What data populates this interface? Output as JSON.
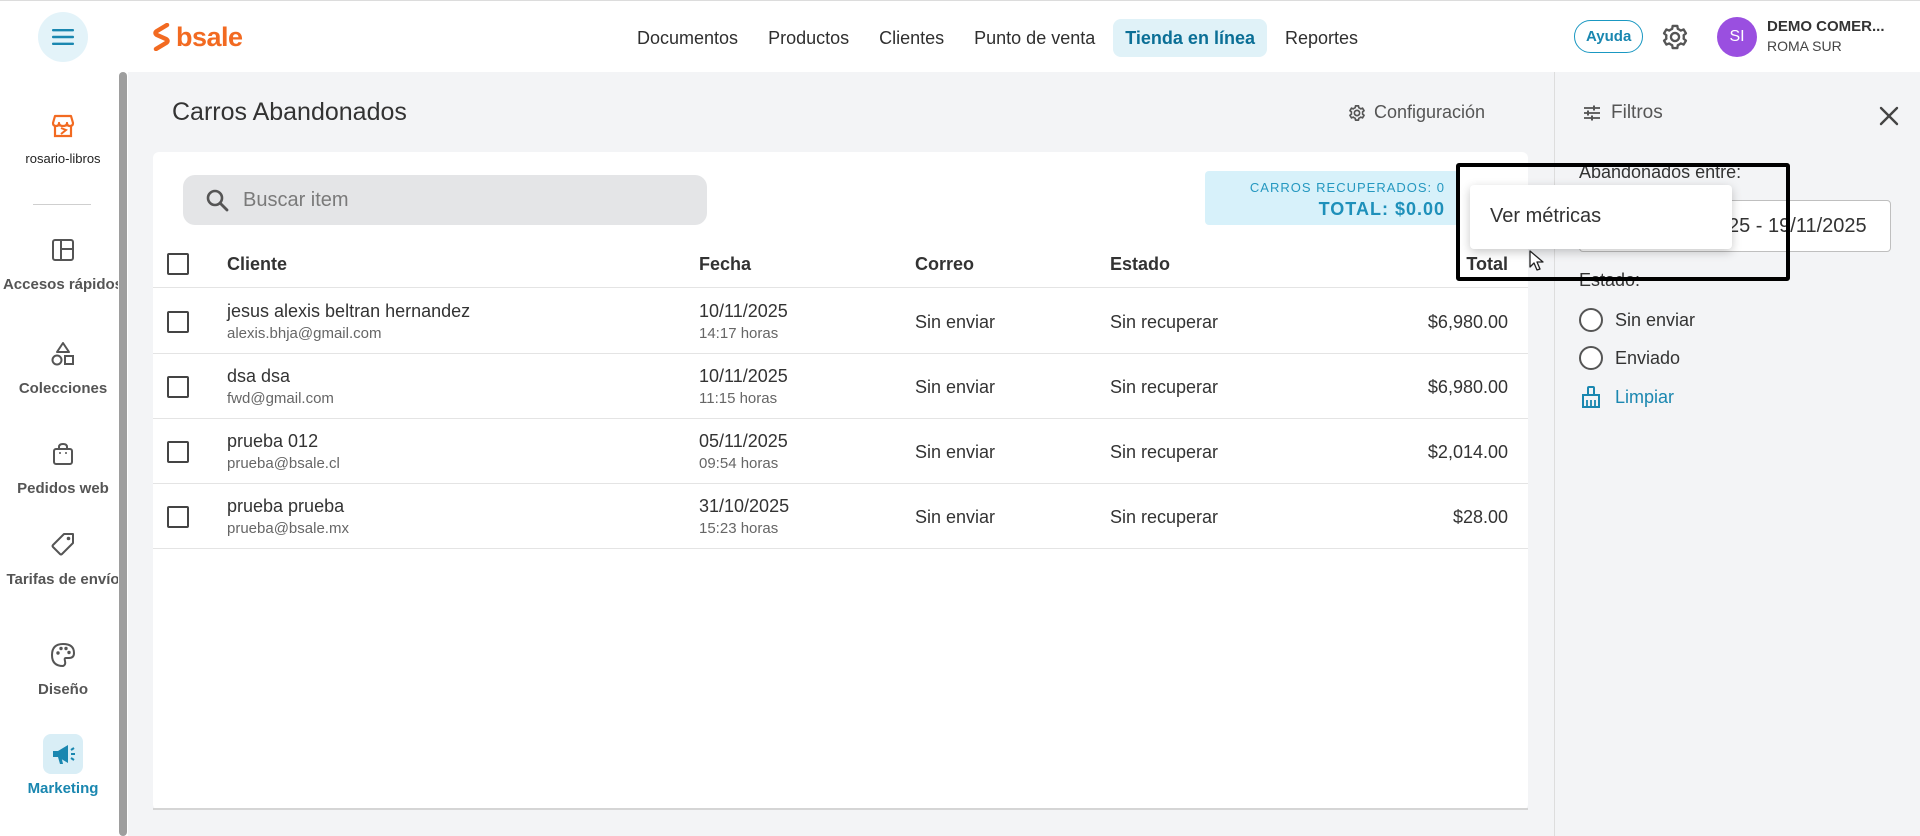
{
  "topbar": {
    "logo_text": "bsale",
    "nav": [
      "Documentos",
      "Productos",
      "Clientes",
      "Punto de venta",
      "Tienda en línea",
      "Reportes"
    ],
    "active_nav_index": 4,
    "help_label": "Ayuda",
    "avatar_initials": "SI",
    "company_name": "DEMO COMER...",
    "company_sub": "ROMA SUR"
  },
  "sidebar": {
    "store_label": "rosario-libros",
    "items": [
      {
        "label": "Accesos rápidos",
        "icon": "layout-icon"
      },
      {
        "label": "Colecciones",
        "icon": "shapes-icon"
      },
      {
        "label": "Pedidos web",
        "icon": "shopping-bag-icon"
      },
      {
        "label": "Tarifas de envío",
        "icon": "tag-icon"
      },
      {
        "label": "Diseño",
        "icon": "palette-icon"
      },
      {
        "label": "Marketing",
        "icon": "megaphone-icon"
      }
    ],
    "active_index": 5
  },
  "main": {
    "title": "Carros Abandonados",
    "config_label": "Configuración",
    "search_placeholder": "Buscar item",
    "metrics": {
      "recovered_label": "CARROS RECUPERADOS: 0",
      "total_label": "TOTAL: $0.00"
    },
    "columns": {
      "cliente": "Cliente",
      "fecha": "Fecha",
      "correo": "Correo",
      "estado": "Estado",
      "total": "Total"
    },
    "rows": [
      {
        "name": "jesus alexis beltran hernandez",
        "email": "alexis.bhja@gmail.com",
        "date": "10/11/2025",
        "time": "14:17 horas",
        "correo": "Sin enviar",
        "estado": "Sin recuperar",
        "total": "$6,980.00"
      },
      {
        "name": "dsa dsa",
        "email": "fwd@gmail.com",
        "date": "10/11/2025",
        "time": "11:15 horas",
        "correo": "Sin enviar",
        "estado": "Sin recuperar",
        "total": "$6,980.00"
      },
      {
        "name": "prueba 012",
        "email": "prueba@bsale.cl",
        "date": "05/11/2025",
        "time": "09:54 horas",
        "correo": "Sin enviar",
        "estado": "Sin recuperar",
        "total": "$2,014.00"
      },
      {
        "name": "prueba prueba",
        "email": "prueba@bsale.mx",
        "date": "31/10/2025",
        "time": "15:23 horas",
        "correo": "Sin enviar",
        "estado": "Sin recuperar",
        "total": "$28.00"
      }
    ]
  },
  "filters": {
    "title": "Filtros",
    "abandoned_between_label": "Abandonados entre:",
    "date_range_visible": "25 - 19/11/2025",
    "estado_label": "Estado:",
    "options": [
      "Sin enviar",
      "Enviado"
    ],
    "clear_label": "Limpiar"
  },
  "dropdown": {
    "item": "Ver métricas"
  },
  "colors": {
    "brand_orange": "#f26a21",
    "accent_blue": "#1a87b0",
    "active_nav_bg": "#e0f2f8",
    "avatar": "#9a4fe0"
  }
}
